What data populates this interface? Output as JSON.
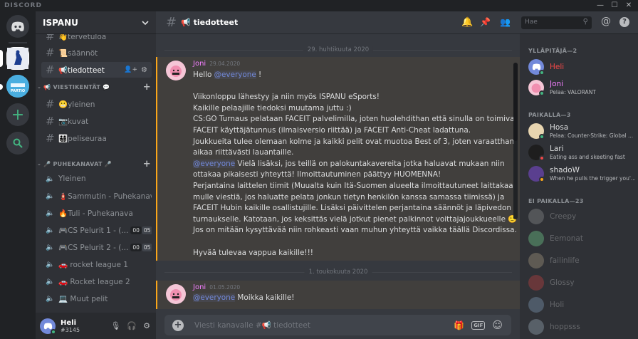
{
  "app": {
    "brand": "DISCORD"
  },
  "colors": {
    "accent": "#7289da",
    "online": "#43b581",
    "dnd": "#f04747",
    "idle": "#faa61a",
    "green": "#43b581"
  },
  "server": {
    "name": "ISPANU"
  },
  "channels": {
    "top": [
      {
        "name": "👋tervetuloa"
      },
      {
        "name": "📜säännöt"
      },
      {
        "name": "📢tiedotteet"
      }
    ],
    "cat1": {
      "label": "📢 VIESTIKENTÄT 💬",
      "items": [
        {
          "name": "😬yleinen"
        },
        {
          "name": "📷kuvat"
        },
        {
          "name": "👨‍👩‍👧‍👦peliseuraa"
        }
      ]
    },
    "cat2": {
      "label": "🎤 PUHEKANAVAT 🎤",
      "items": [
        {
          "name": "Yleinen"
        },
        {
          "name": "🧯Sammutin - Puhekanava"
        },
        {
          "name": "🔥Tuli - Puhekanava"
        },
        {
          "name": "🎮CS Pelurit 1 - (...",
          "c1": "00",
          "c2": "05"
        },
        {
          "name": "🎮CS Pelurit 2 - (...",
          "c1": "00",
          "c2": "05"
        },
        {
          "name": "🚗 rocket league 1"
        },
        {
          "name": "🚗 Rocket league 2"
        },
        {
          "name": "💻 Muut pelit"
        }
      ]
    }
  },
  "user": {
    "name": "Heli",
    "tag": "#3145"
  },
  "header": {
    "channel": "📢 tiedotteet",
    "search_placeholder": "Hae"
  },
  "messages": {
    "div1": "29. huhtikuuta 2020",
    "div2": "1. toukokuuta 2020",
    "m1": {
      "author": "Joni",
      "time": "29.04.2020",
      "l1a": "Hello ",
      "l1m": "@everyone",
      "l1b": " !",
      "p1": "Viikonloppu lähestyy ja niin myös ISPANU eSports!",
      "p2": "Kaikille pelaajille tiedoksi muutama juttu :)",
      "p3": "CS:GO Turnaus pelataan FACEIT palvelimilla, joten huolehdithan että sinulla on toimiva",
      "p4": "FACEIT käyttäjätunnus (ilmaisversio riittää) ja FACEIT Anti-Cheat ladattuna.",
      "p5": "Joukkueita tulee olemaan kolme ja kaikki pelit ovat muotoa Best of 3, joten varaatthan",
      "p6": "aikaa riittävästi lauantaille.",
      "q1m": "@everyone",
      "q1": " Vielä lisäksi, jos teillä on palokuntakavereita jotka haluavat mukaan niin",
      "q2": "ottakaa pikaisesti yhteyttä! Ilmoittautuminen päättyy HUOMENNA!",
      "q3": "Perjantaina laittelen tiimit (Muualta kuin Itä-Suomen alueelta ilmoittautuneet laittakaa",
      "q4": "mulle viestiä, jos haluatte pelata jonkun tietyn henkilön kanssa samassa tiimissä) ja",
      "q5": "FACEIT Hubin kaikille osallistujille. Lisäksi päivittelen perjantaina säännöt ja läpivedon",
      "q6": "turnaukselle. Katotaan, jos keksittäs vielä jotkut pienet palkinnot voittajajoukkueelle 🙂",
      "q7": "Jos on mitään kysyttävää niin rohkeasti vaan muhun yhteyttä vaikka täällä Discordissa.",
      "q8": "Hyvää tulevaa vappua kaikille!!!"
    },
    "m2": {
      "author": "Joni",
      "time": "01.05.2020",
      "m": "@everyone",
      "t": " Moikka kaikille!"
    }
  },
  "composer": {
    "placeholder": "Viesti kanavalle #📢 tiedotteet"
  },
  "members": {
    "admin": "YLLÄPITÄJÄ—2",
    "online": "PAIKALLA—3",
    "offline": "EI PAIKALLA—23",
    "list_admin": [
      {
        "name": "Heli",
        "status": ""
      },
      {
        "name": "Joni",
        "status": "Pelaa: VALORANT"
      }
    ],
    "list_online": [
      {
        "name": "Hosa",
        "status": "Pelaa: Counter-Strike: Global ..."
      },
      {
        "name": "Lari",
        "status": "Eating ass and skeeting fast"
      },
      {
        "name": "shadoW",
        "status": "When he pulls the trigger you'..."
      }
    ],
    "list_offline": [
      {
        "name": "Creepy"
      },
      {
        "name": "Eemonat"
      },
      {
        "name": "failinlife"
      },
      {
        "name": "Glossy"
      },
      {
        "name": "Holi"
      },
      {
        "name": "hoppsss"
      }
    ]
  }
}
